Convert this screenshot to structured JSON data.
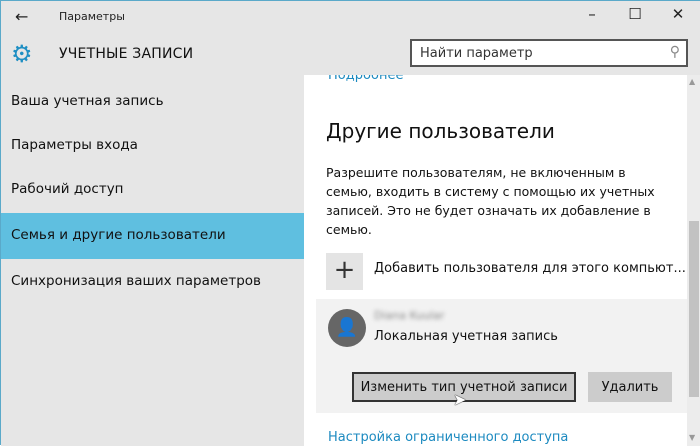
{
  "window": {
    "title": "Параметры",
    "back": "←",
    "minimize": "–",
    "maximize": "☐",
    "close": "✕"
  },
  "header": {
    "title": "УЧЕТНЫЕ ЗАПИСИ",
    "search_placeholder": "Найти параметр",
    "icon": "gear-icon",
    "accent": "#1f8fc3"
  },
  "sidebar": {
    "items": [
      {
        "label": "Ваша учетная запись"
      },
      {
        "label": "Параметры входа"
      },
      {
        "label": "Рабочий доступ"
      },
      {
        "label": "Семья и другие пользователи",
        "selected": true
      },
      {
        "label": "Синхронизация ваших параметров"
      }
    ],
    "selected_color": "#5fbfe0"
  },
  "main": {
    "top_link": "Подробнее",
    "heading": "Другие пользователи",
    "description": "Разрешите пользователям, не включенным в семью, входить в систему с помощью их учетных записей. Это не будет означать их добавление в семью.",
    "add_user": "Добавить пользователя для этого компьют...",
    "user": {
      "name": "Diana Kuular",
      "type": "Локальная учетная запись",
      "change_type": "Изменить тип учетной записи",
      "delete": "Удалить"
    },
    "bottom_link": "Настройка ограниченного доступа"
  }
}
